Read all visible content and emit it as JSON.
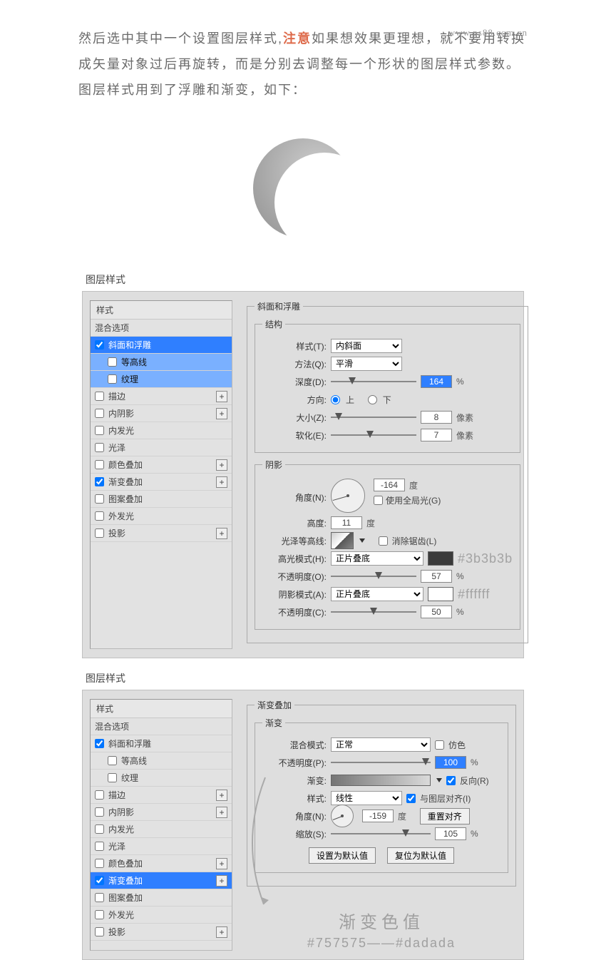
{
  "watermark": "www.ps88.com.cn",
  "intro": {
    "p1a": "然后选中其中一个设置图层样式,",
    "em": "注意",
    "p1b": "如果想效果更理想，就不要用转换成矢量对象过后再旋转，而是分别去调整每一个形状的图层样式参数。图层样式用到了浮雕和渐变，如下："
  },
  "section_title": "图层样式",
  "styles": {
    "header_styles": "样式",
    "blend_options": "混合选项",
    "bevel": "斜面和浮雕",
    "contour": "等高线",
    "texture": "纹理",
    "stroke": "描边",
    "inner_shadow": "内阴影",
    "inner_glow": "内发光",
    "satin": "光泽",
    "color_overlay": "颜色叠加",
    "gradient_overlay": "渐变叠加",
    "pattern_overlay": "图案叠加",
    "outer_glow": "外发光",
    "drop_shadow": "投影"
  },
  "bevel": {
    "group": "斜面和浮雕",
    "structure": "结构",
    "style_label": "样式(T):",
    "style_value": "内斜面",
    "method_label": "方法(Q):",
    "method_value": "平滑",
    "depth_label": "深度(D):",
    "depth_value": "164",
    "pct": "%",
    "dir_label": "方向:",
    "dir_up": "上",
    "dir_down": "下",
    "size_label": "大小(Z):",
    "size_value": "8",
    "px": "像素",
    "soften_label": "软化(E):",
    "soften_value": "7",
    "shadow": "阴影",
    "angle_label": "角度(N):",
    "angle_value": "-164",
    "deg": "度",
    "global_light": "使用全局光(G)",
    "altitude_label": "高度:",
    "altitude_value": "11",
    "gloss_label": "光泽等高线:",
    "antialias": "消除锯齿(L)",
    "highlight_mode_label": "高光模式(H):",
    "highlight_mode_value": "正片叠底",
    "highlight_color": "#3b3b3b",
    "opacity1_label": "不透明度(O):",
    "opacity1_value": "57",
    "shadow_mode_label": "阴影模式(A):",
    "shadow_mode_value": "正片叠底",
    "shadow_color": "#ffffff",
    "opacity2_label": "不透明度(C):",
    "opacity2_value": "50"
  },
  "grad": {
    "group": "渐变叠加",
    "sub": "渐变",
    "mode_label": "混合模式:",
    "mode_value": "正常",
    "dither": "仿色",
    "opacity_label": "不透明度(P):",
    "opacity_value": "100",
    "grad_label": "渐变:",
    "reverse": "反向(R)",
    "style_label": "样式:",
    "style_value": "线性",
    "align": "与图层对齐(I)",
    "angle_label": "角度(N):",
    "angle_value": "-159",
    "deg": "度",
    "reset_align": "重置对齐",
    "scale_label": "缩放(S):",
    "scale_value": "105",
    "pct": "%",
    "set_default": "设置为默认值",
    "reset_default": "复位为默认值",
    "legend_title": "渐变色值",
    "legend_hex": "#757575——#dadada"
  }
}
